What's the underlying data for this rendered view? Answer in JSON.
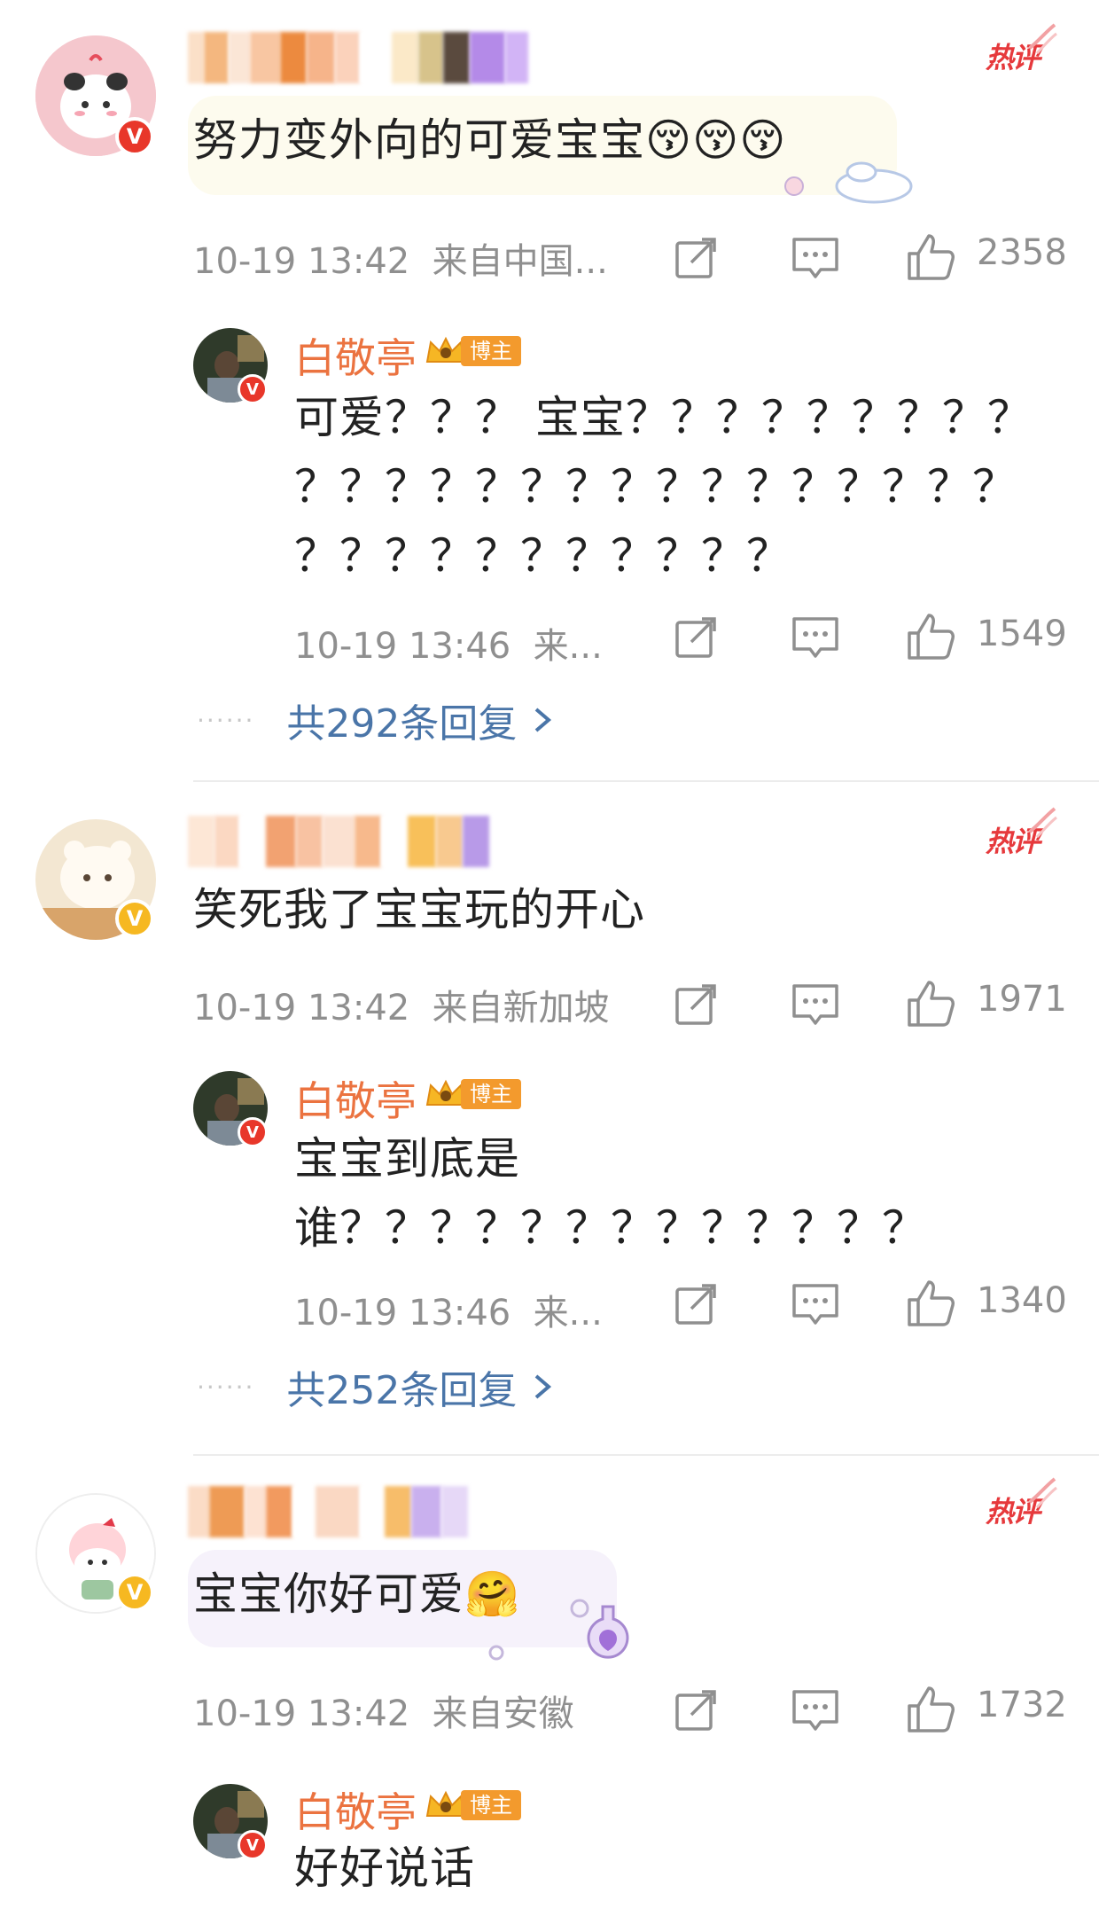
{
  "comments": [
    {
      "tag": "热评",
      "text": "努力变外向的可爱宝宝😚😚😚",
      "time": "10-19 13:42",
      "location": "来自中国...",
      "likes": "2358",
      "reply": {
        "author": "白敬亭",
        "badge": "博主",
        "text_lines": [
          "可爱？？？ 宝宝？？？？？？？？？",
          "？？？？？？？？？？？？？？？？",
          "？？？？？？？？？？？"
        ],
        "time": "10-19 13:46",
        "location": "来...",
        "likes": "1549"
      },
      "more_replies": "共292条回复"
    },
    {
      "tag": "热评",
      "text": "笑死我了宝宝玩的开心",
      "time": "10-19 13:42",
      "location": "来自新加坡",
      "likes": "1971",
      "reply": {
        "author": "白敬亭",
        "badge": "博主",
        "text_lines": [
          "宝宝到底是",
          "谁？？？？？？？？？？？？？"
        ],
        "time": "10-19 13:46",
        "location": "来...",
        "likes": "1340"
      },
      "more_replies": "共252条回复"
    },
    {
      "tag": "热评",
      "text": "宝宝你好可爱🤗",
      "time": "10-19 13:42",
      "location": "来自安徽",
      "likes": "1732",
      "reply": {
        "author": "白敬亭",
        "badge": "博主",
        "text_lines": [
          "好好说话"
        ]
      }
    }
  ],
  "colors": {
    "hot_tag": "#e6393c",
    "blogger_name": "#eb7340",
    "link": "#4a75a8",
    "meta": "#8f8f8f"
  },
  "icons": [
    "share-icon",
    "comment-icon",
    "like-icon",
    "verified-icon",
    "crown-icon",
    "chevron-right-icon"
  ]
}
